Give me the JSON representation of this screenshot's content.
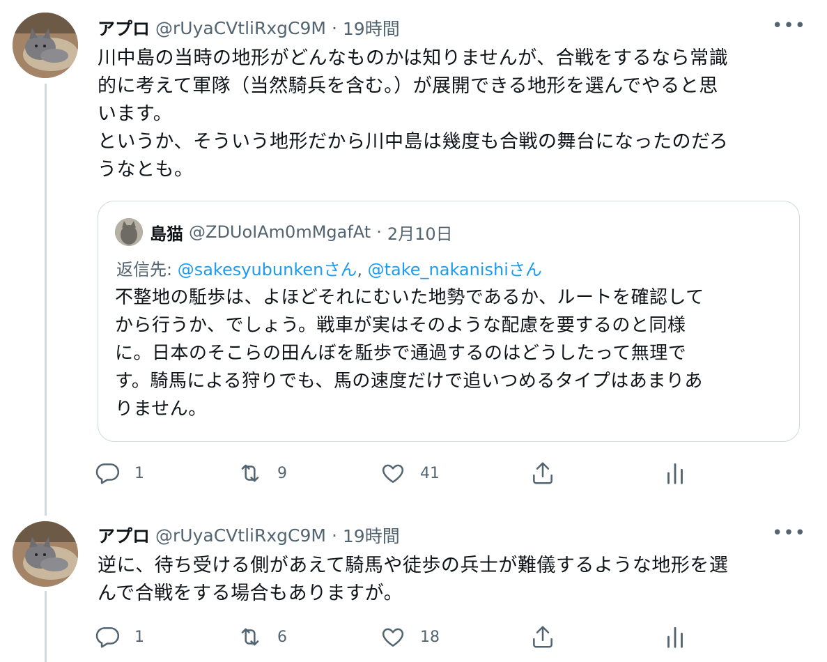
{
  "tweets": [
    {
      "author": {
        "name": "アプロ",
        "handle": "@rUyaCVtliRxgC9M",
        "time": "19時間"
      },
      "text": "川中島の当時の地形がどんなものかは知りませんが、合戦をするなら常識\n的に考えて軍隊（当然騎兵を含む。）が展開できる地形を選んでやると思\nいます。\nというか、そういう地形だから川中島は幾度も合戦の舞台になったのだろ\nうなとも。",
      "quote": {
        "author": {
          "name": "島猫",
          "handle": "@ZDUoIAm0mMgafAt",
          "time": "2月10日"
        },
        "reply_prefix": "返信先: ",
        "reply_to_1": "@sakesyubunkenさん",
        "reply_sep": ", ",
        "reply_to_2": "@take_nakanishiさん",
        "text": "不整地の駈歩は、よほどそれにむいた地勢であるか、ルートを確認して\nから行うか、でしょう。戦車が実はそのような配慮を要するのと同様\nに。日本のそこらの田んぼを駈歩で通過するのはどうしたって無理で\nす。騎馬による狩りでも、馬の速度だけで追いつめるタイプはあまりあ\nりません。"
      },
      "stats": {
        "replies": "1",
        "retweets": "9",
        "likes": "41"
      }
    },
    {
      "author": {
        "name": "アプロ",
        "handle": "@rUyaCVtliRxgC9M",
        "time": "19時間"
      },
      "text": "逆に、待ち受ける側があえて騎馬や徒歩の兵士が難儀するような地形を選\nんで合戦をする場合もありますが。",
      "stats": {
        "replies": "1",
        "retweets": "6",
        "likes": "18"
      }
    }
  ],
  "ui": {
    "separator": "·",
    "more": "•••"
  },
  "icons": {
    "reply": "reply-icon",
    "retweet": "retweet-icon",
    "like": "heart-icon",
    "share": "share-icon",
    "analytics": "analytics-icon",
    "more": "more-icon"
  },
  "colors": {
    "secondary_text": "#536471",
    "link": "#1d9bf0",
    "border": "#cfd9de"
  }
}
